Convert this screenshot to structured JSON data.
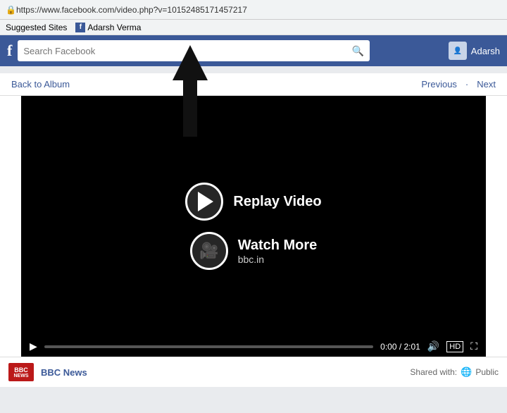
{
  "browser": {
    "url": "https://www.facebook.com/video.php?v=10152485171457217",
    "lock_symbol": "🔒",
    "bookmarks": [
      {
        "label": "Suggested Sites"
      },
      {
        "label": "Adarsh Verma",
        "has_fb_icon": true
      }
    ]
  },
  "header": {
    "logo": "f",
    "search_placeholder": "Search Facebook",
    "user_name": "Adarsh"
  },
  "nav": {
    "back_label": "Back to Album",
    "prev_label": "Previous",
    "sep": "·",
    "next_label": "Next"
  },
  "video": {
    "replay_label": "Replay Video",
    "watch_label": "Watch More",
    "watch_sublabel": "bbc.in",
    "time_display": "0:00 / 2:01",
    "quality_label": "HD"
  },
  "post": {
    "source": "BBC News",
    "shared_label": "Shared with:",
    "visibility": "Public"
  },
  "arrow": {
    "description": "black arrow pointing upward toward search bar"
  }
}
